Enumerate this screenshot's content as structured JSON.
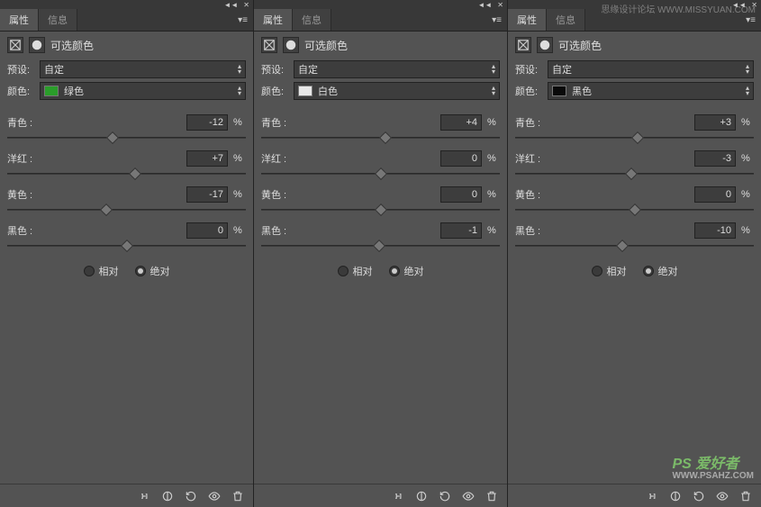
{
  "tabs": {
    "active": "属性",
    "inactive": "信息"
  },
  "panel_title": "可选颜色",
  "preset_label": "预设:",
  "preset_value": "自定",
  "color_label": "颜色:",
  "sliders": {
    "cyan": "青色 :",
    "magenta": "洋红 :",
    "yellow": "黄色 :",
    "black": "黑色 :",
    "percent": "%"
  },
  "mode": {
    "relative": "相对",
    "absolute": "绝对",
    "selected": "absolute"
  },
  "panels": [
    {
      "color_name": "绿色",
      "swatch": "#2a9d2a",
      "values": {
        "cyan": -12,
        "magenta": 7,
        "yellow": -17,
        "black": 0
      }
    },
    {
      "color_name": "白色",
      "swatch": "#e8e8e8",
      "values": {
        "cyan": 4,
        "magenta": 0,
        "yellow": 0,
        "black": -1
      }
    },
    {
      "color_name": "黑色",
      "swatch": "#0a0a0a",
      "values": {
        "cyan": 3,
        "magenta": -3,
        "yellow": 0,
        "black": -10
      }
    }
  ],
  "watermarks": {
    "top": "思缘设计论坛  WWW.MISSYUAN.COM",
    "bottom_main": "PS 爱好者",
    "bottom_sub": "WWW.PSAHZ.COM"
  }
}
